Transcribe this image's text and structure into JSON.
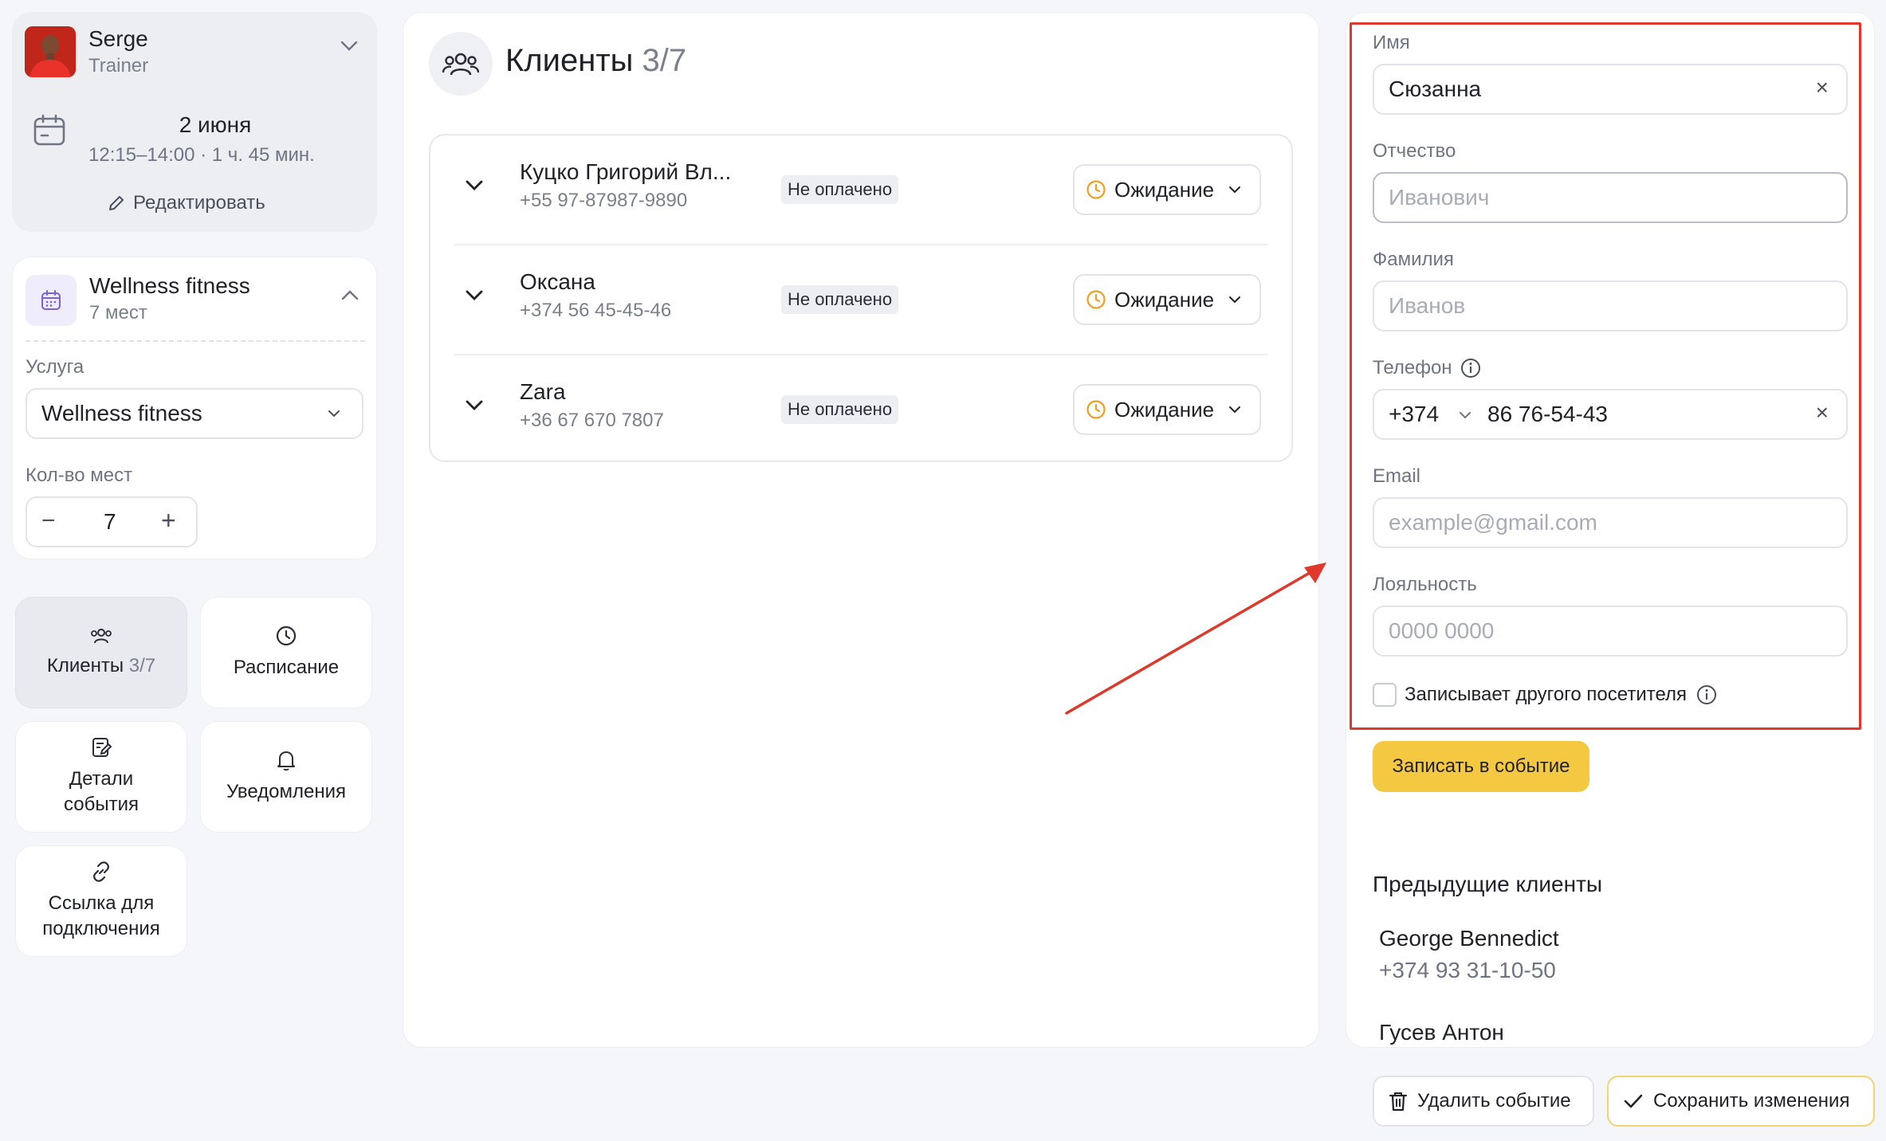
{
  "user": {
    "name": "Serge",
    "role": "Trainer"
  },
  "event": {
    "date": "2 июня",
    "time": "12:15–14:00 · 1 ч. 45 мин.",
    "edit_label": "Редактировать"
  },
  "service": {
    "name": "Wellness fitness",
    "seats": "7 мест",
    "service_label": "Услуга",
    "service_value": "Wellness fitness",
    "seats_label": "Кол-во мест",
    "seats_value": "7",
    "minus": "−",
    "plus": "+"
  },
  "tiles": {
    "clients": {
      "label": "Клиенты",
      "count": "3/7"
    },
    "schedule": {
      "label": "Расписание"
    },
    "details": {
      "label": "Детали события"
    },
    "notifications": {
      "label": "Уведомления"
    },
    "link": {
      "label": "Ссылка для подключения"
    }
  },
  "clients_panel": {
    "title": "Клиенты",
    "count": "3/7",
    "rows": [
      {
        "name": "Куцко Григорий Вл...",
        "phone": "+55 97-87987-9890",
        "payment": "Не оплачено",
        "status": "Ожидание"
      },
      {
        "name": "Оксана",
        "phone": "+374 56 45-45-46",
        "payment": "Не оплачено",
        "status": "Ожидание"
      },
      {
        "name": "Zara",
        "phone": "+36 67 670 7807",
        "payment": "Не оплачено",
        "status": "Ожидание"
      }
    ]
  },
  "form": {
    "first_name": {
      "label": "Имя",
      "value": "Сюзанна"
    },
    "middle_name": {
      "label": "Отчество",
      "placeholder": "Иванович"
    },
    "last_name": {
      "label": "Фамилия",
      "placeholder": "Иванов"
    },
    "phone": {
      "label": "Телефон",
      "code": "+374",
      "value": "86 76-54-43"
    },
    "email": {
      "label": "Email",
      "placeholder": "example@gmail.com"
    },
    "loyalty": {
      "label": "Лояльность",
      "placeholder": "0000 0000"
    },
    "other_visitor": {
      "label": "Записывает другого посетителя",
      "checked": false
    },
    "submit_label": "Записать в событие",
    "clear_symbol": "×"
  },
  "previous_clients": {
    "title": "Предыдущие клиенты",
    "items": [
      {
        "name": "George Bennedict",
        "phone": "+374 93 31-10-50"
      },
      {
        "name": "Гусев Антон"
      }
    ]
  },
  "actions": {
    "delete_label": "Удалить событие",
    "save_label": "Сохранить изменения"
  },
  "colors": {
    "accent_yellow": "#f5c842",
    "highlight_red": "#e0392b",
    "status_clock": "#f0a020",
    "service_icon": "#7b61d9"
  }
}
